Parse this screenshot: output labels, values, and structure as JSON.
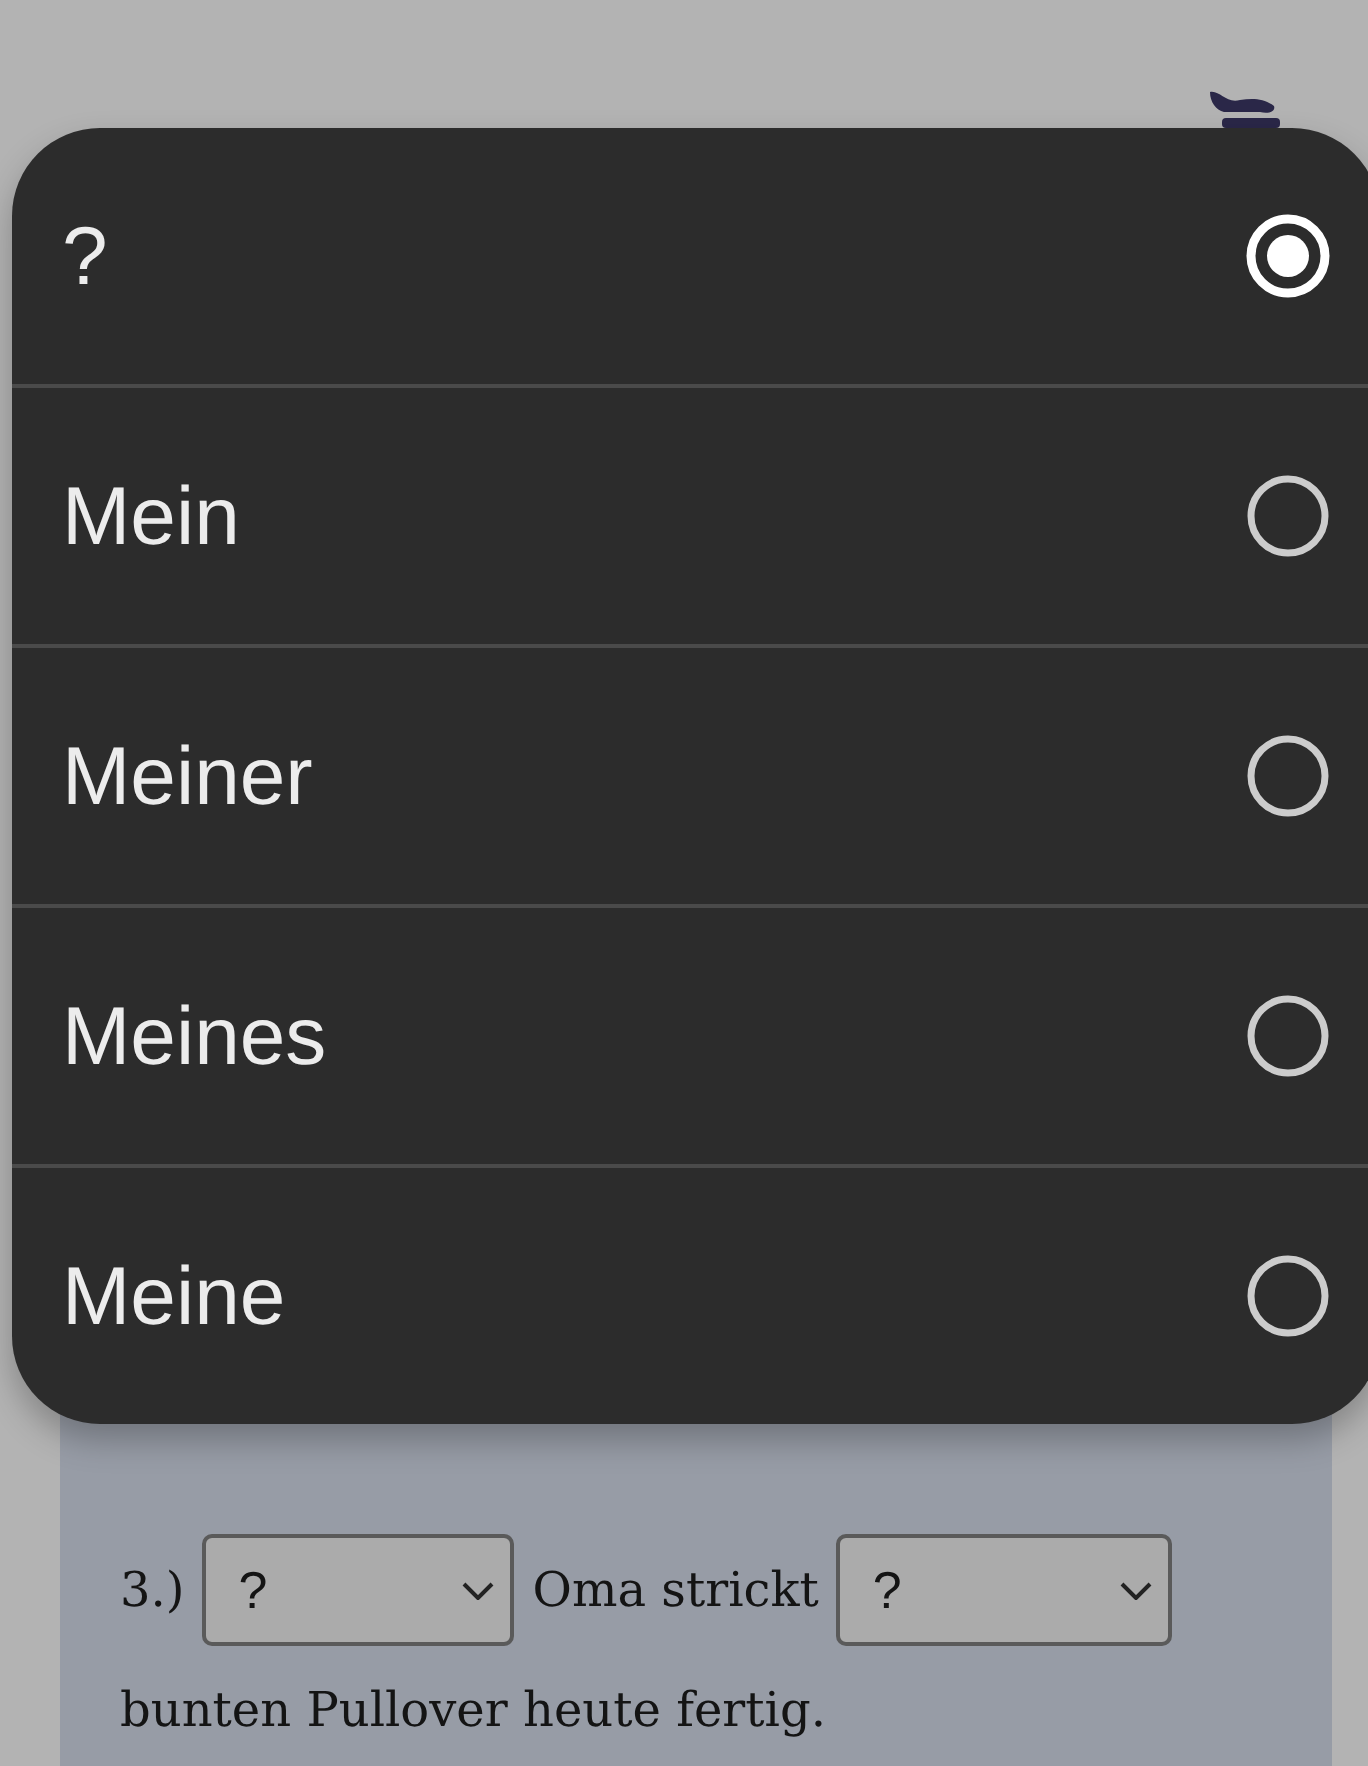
{
  "picker": {
    "options": [
      {
        "label": "?",
        "selected": true
      },
      {
        "label": "Mein",
        "selected": false
      },
      {
        "label": "Meiner",
        "selected": false
      },
      {
        "label": "Meines",
        "selected": false
      },
      {
        "label": "Meine",
        "selected": false
      }
    ]
  },
  "exercise": {
    "number": "3.)",
    "parts": [
      {
        "kind": "select",
        "value": "?"
      },
      {
        "kind": "text",
        "text": "Oma strickt"
      },
      {
        "kind": "select",
        "value": "?"
      },
      {
        "kind": "text",
        "text": "bunten Pullover heute fertig."
      }
    ]
  }
}
